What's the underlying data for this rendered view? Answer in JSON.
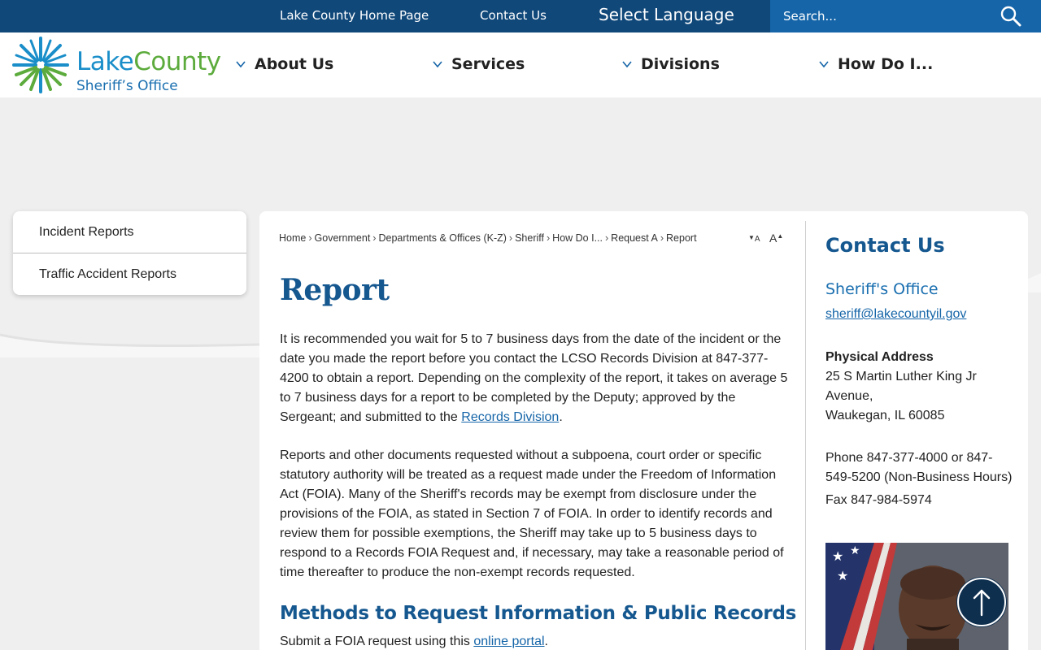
{
  "colors": {
    "brand_navy": "#10487a",
    "brand_blue": "#1565a8",
    "heading_blue": "#15578f",
    "logo_green": "#5cab3c",
    "logo_blue": "#1a8ec9"
  },
  "topbar": {
    "links": [
      "Lake County Home Page",
      "Contact Us"
    ],
    "language_label": "Select Language",
    "search_placeholder": "Search...",
    "search_icon": "magnifier-icon"
  },
  "logo": {
    "name_part1": "Lake",
    "name_part2": "County",
    "subtitle": "Sheriff’s Office"
  },
  "nav": [
    {
      "label": "About Us",
      "icon": "chevron-down-icon"
    },
    {
      "label": "Services",
      "icon": "chevron-down-icon"
    },
    {
      "label": "Divisions",
      "icon": "chevron-down-icon"
    },
    {
      "label": "How Do I...",
      "icon": "chevron-down-icon"
    }
  ],
  "sidenav": {
    "items": [
      "Incident Reports",
      "Traffic Accident Reports"
    ]
  },
  "breadcrumb": [
    "Home",
    "Government",
    "Departments & Offices (K-Z)",
    "Sheriff",
    "How Do I...",
    "Request A",
    "Report"
  ],
  "font_controls": {
    "decrease": "A",
    "increase": "A"
  },
  "main": {
    "title": "Report",
    "para1_text": "It is recommended you wait for 5 to 7 business days from the date of the incident or the date you made the report before you contact the LCSO Records Division at 847-377-4200 to obtain a report. Depending on the complexity of the report, it takes on average 5 to 7 business days for a report to be completed by the Deputy; approved by the Sergeant; and submitted to the ",
    "para1_link": "Records Division",
    "para1_end": ".",
    "para2": "Reports and other documents requested without a subpoena, court order or specific statutory authority will be treated as a request made under the Freedom of Information Act (FOIA). Many of the Sheriff's records may be exempt from disclosure under the provisions of the FOIA, as stated in Section 7 of FOIA. In order to identify records and review them for possible exemptions, the Sheriff may take up to 5 business days to respond to a Records FOIA Request and, if necessary, may take a reasonable period of time thereafter to produce the non-exempt records requested.",
    "section_heading": "Methods to Request Information & Public Records",
    "para3_text": "Submit a FOIA request using this ",
    "para3_link": "online portal",
    "para3_end": "."
  },
  "contact": {
    "heading": "Contact Us",
    "office": "Sheriff's Office",
    "email": "sheriff@lakecountyil.gov",
    "address_label": "Physical Address",
    "address_line1": "25 S Martin Luther King Jr Avenue,",
    "address_line2": "Waukegan, IL 60085",
    "phone": "Phone 847-377-4000 or 847-549-5200 (Non-Business Hours)",
    "fax": "Fax 847-984-5974"
  },
  "back_to_top_icon": "arrow-up-icon"
}
